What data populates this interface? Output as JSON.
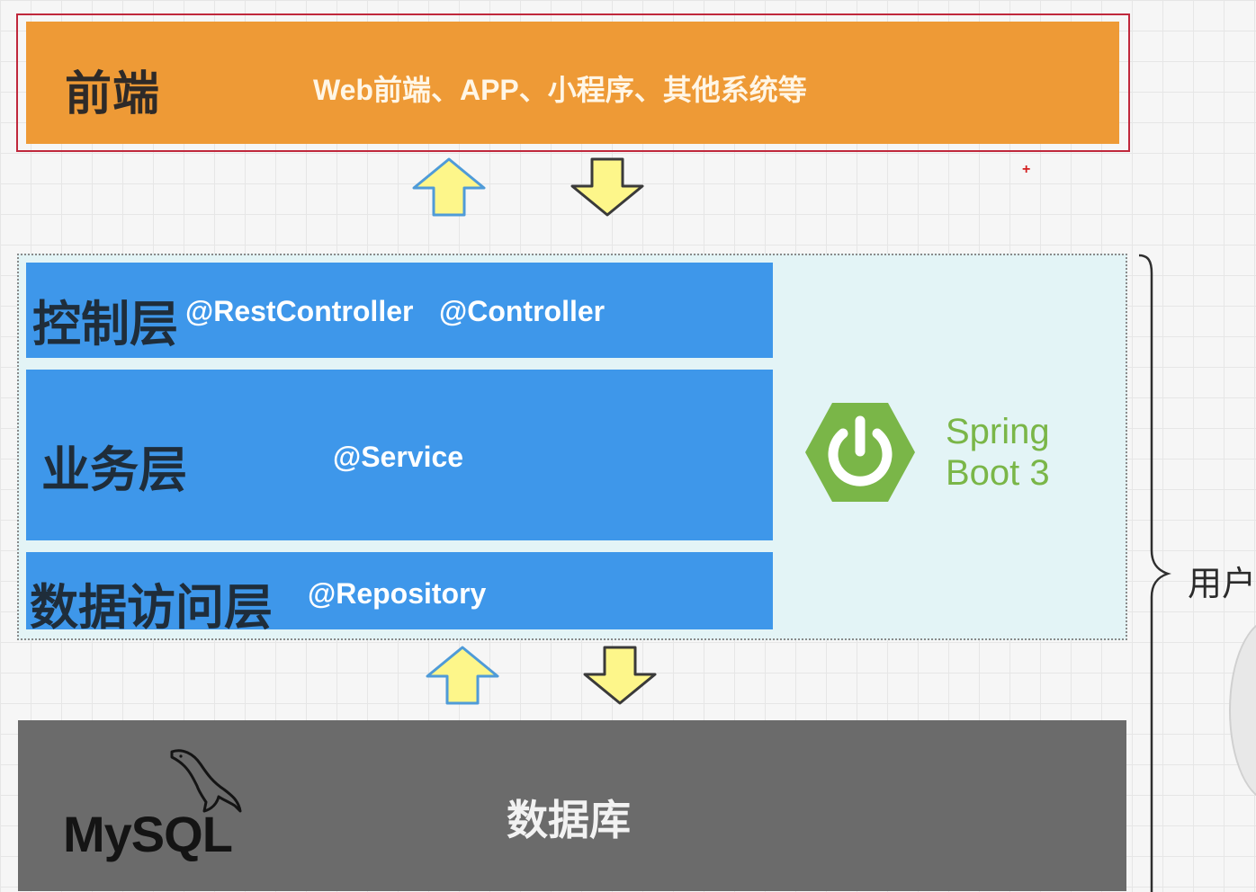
{
  "frontend": {
    "title": "前端",
    "description": "Web前端、APP、小程序、其他系统等"
  },
  "layers": {
    "controller": {
      "title": "控制层",
      "annotations": [
        "@RestController",
        "@Controller"
      ]
    },
    "service": {
      "title": "业务层",
      "annotation": "@Service"
    },
    "data_access": {
      "title": "数据访问层",
      "annotation": "@Repository"
    }
  },
  "framework": {
    "line1": "Spring",
    "line2": "Boot 3",
    "logo_icon": "spring-power-hexagon-icon",
    "color": "#7ab648"
  },
  "database": {
    "label": "数据库",
    "brand": "MySQL",
    "brand_icon": "mysql-dolphin-icon"
  },
  "brace_label": "用户",
  "colors": {
    "frontend": "#ee9a36",
    "layer": "#3e97ea",
    "backend_bg": "#e3f4f6",
    "database": "#6b6b6b",
    "arrow": "#fdf68a"
  }
}
